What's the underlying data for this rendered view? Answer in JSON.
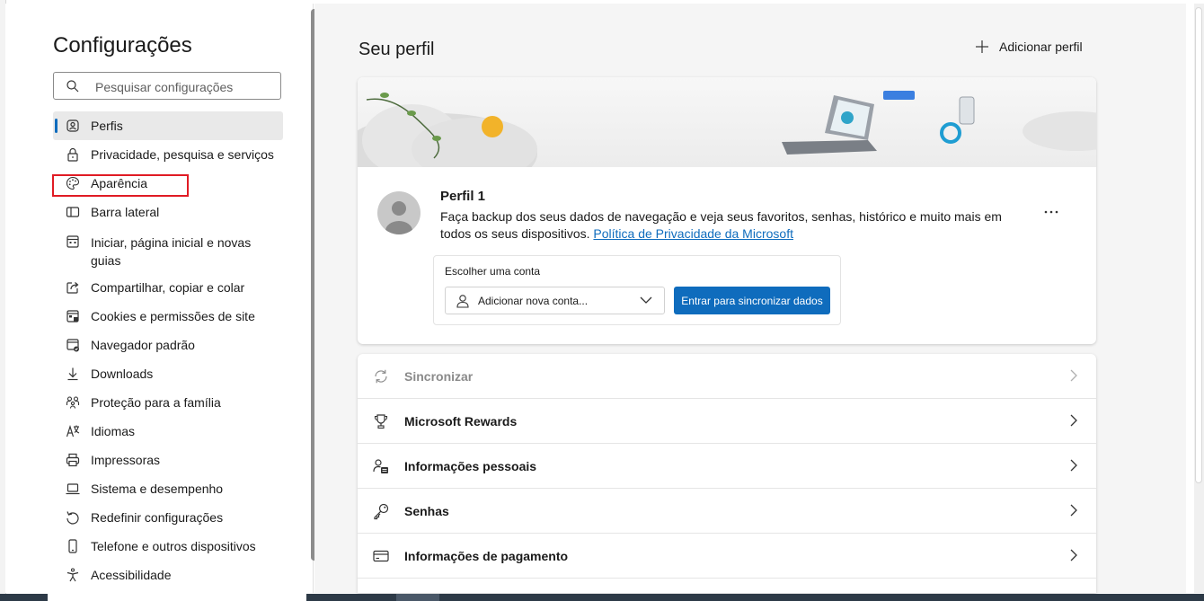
{
  "sidebar": {
    "title": "Configurações",
    "search_placeholder": "Pesquisar configurações",
    "items": [
      {
        "label": "Perfis",
        "icon": "profile-icon"
      },
      {
        "label": "Privacidade, pesquisa e serviços",
        "icon": "lock-icon"
      },
      {
        "label": "Aparência",
        "icon": "palette-icon"
      },
      {
        "label": "Barra lateral",
        "icon": "sidebar-icon"
      },
      {
        "label": "Iniciar, página inicial e novas guias",
        "icon": "home-grid-icon"
      },
      {
        "label": "Compartilhar, copiar e colar",
        "icon": "share-icon"
      },
      {
        "label": "Cookies e permissões de site",
        "icon": "cookie-icon"
      },
      {
        "label": "Navegador padrão",
        "icon": "browser-icon"
      },
      {
        "label": "Downloads",
        "icon": "download-icon"
      },
      {
        "label": "Proteção para a família",
        "icon": "family-icon"
      },
      {
        "label": "Idiomas",
        "icon": "language-icon"
      },
      {
        "label": "Impressoras",
        "icon": "printer-icon"
      },
      {
        "label": "Sistema e desempenho",
        "icon": "laptop-icon"
      },
      {
        "label": "Redefinir configurações",
        "icon": "reset-icon"
      },
      {
        "label": "Telefone e outros dispositivos",
        "icon": "phone-icon"
      },
      {
        "label": "Acessibilidade",
        "icon": "accessibility-icon"
      }
    ],
    "active_index": 0,
    "highlighted_item": "Aparência"
  },
  "main": {
    "heading": "Seu perfil",
    "add_profile_label": "Adicionar perfil",
    "profile": {
      "name": "Perfil 1",
      "description": "Faça backup dos seus dados de navegação e veja seus favoritos, senhas, histórico e muito mais em todos os seus dispositivos.",
      "privacy_link": "Política de Privacidade da Microsoft"
    },
    "account": {
      "label": "Escolher uma conta",
      "selected": "Adicionar nova conta...",
      "sync_button": "Entrar para sincronizar dados"
    },
    "rows": [
      {
        "label": "Sincronizar",
        "icon": "sync-icon",
        "disabled": true
      },
      {
        "label": "Microsoft Rewards",
        "icon": "trophy-icon",
        "disabled": false
      },
      {
        "label": "Informações pessoais",
        "icon": "person-card-icon",
        "disabled": false
      },
      {
        "label": "Senhas",
        "icon": "key-icon",
        "disabled": false
      },
      {
        "label": "Informações de pagamento",
        "icon": "credit-card-icon",
        "disabled": false
      }
    ]
  },
  "colors": {
    "accent": "#0f6cbd",
    "highlight_box": "#e01b24",
    "active_bg": "#e9e9e9"
  }
}
